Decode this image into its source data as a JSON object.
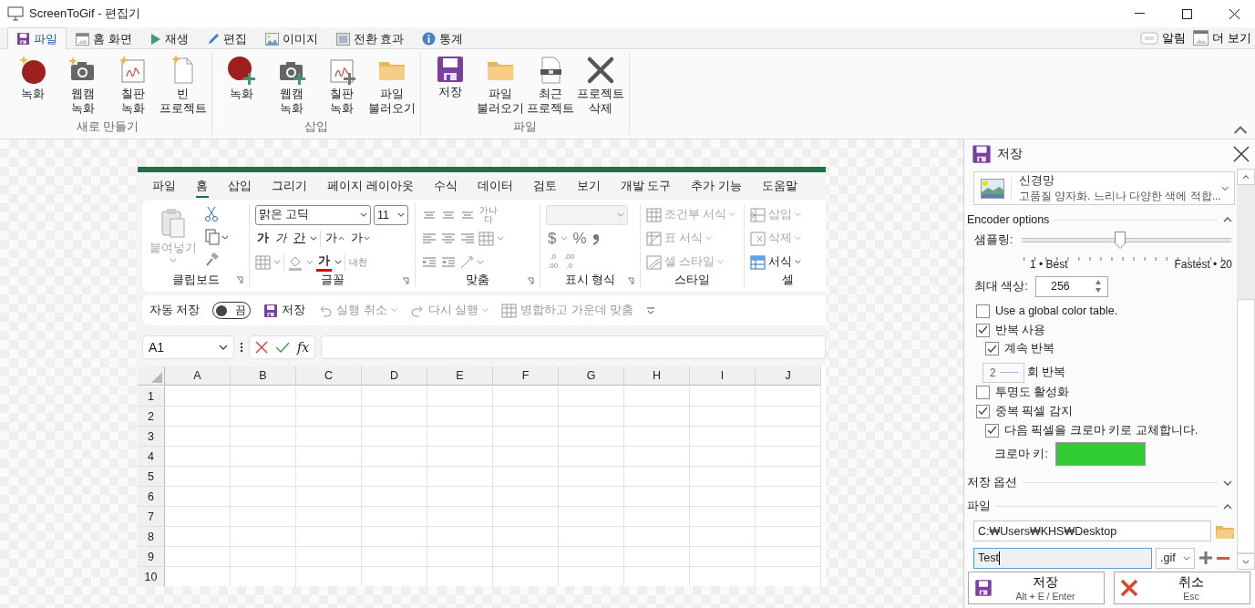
{
  "window": {
    "title": "ScreenToGif - 편집기"
  },
  "tabs": [
    {
      "label": "파일",
      "kind": "save",
      "selected": true
    },
    {
      "label": "홈 화면",
      "kind": "home",
      "selected": false
    },
    {
      "label": "재생",
      "kind": "play",
      "selected": false
    },
    {
      "label": "편집",
      "kind": "pencil",
      "selected": false
    },
    {
      "label": "이미지",
      "kind": "image",
      "selected": false
    },
    {
      "label": "전환 효과",
      "kind": "transition",
      "selected": false
    },
    {
      "label": "통계",
      "kind": "info",
      "selected": false
    }
  ],
  "tab_extras": [
    {
      "label": "알림",
      "kind": "tag"
    },
    {
      "label": "더 보기",
      "kind": "window"
    }
  ],
  "ribbon_groups": [
    {
      "label": "새로 만들기",
      "buttons": [
        {
          "label": "녹화",
          "kind": "record"
        },
        {
          "label": "웹캠\n녹화",
          "kind": "webcam"
        },
        {
          "label": "칠판\n녹화",
          "kind": "board"
        },
        {
          "label": "빈\n프로젝트",
          "kind": "blank"
        }
      ]
    },
    {
      "label": "삽입",
      "buttons": [
        {
          "label": "녹화",
          "kind": "record-add"
        },
        {
          "label": "웹캠\n녹화",
          "kind": "webcam-add"
        },
        {
          "label": "칠판\n녹화",
          "kind": "board-add"
        },
        {
          "label": "파일\n불러오기",
          "kind": "open"
        }
      ]
    },
    {
      "label": "파일",
      "buttons": [
        {
          "label": "저장",
          "kind": "save"
        },
        {
          "label": "파일\n불러오기",
          "kind": "open"
        },
        {
          "label": "최근\n프로젝트",
          "kind": "recent"
        },
        {
          "label": "프로젝트\n삭제",
          "kind": "discard"
        }
      ]
    }
  ],
  "excel": {
    "menu": [
      {
        "label": "파일",
        "selected": false
      },
      {
        "label": "홈",
        "selected": true
      },
      {
        "label": "삽입",
        "selected": false
      },
      {
        "label": "그리기",
        "selected": false
      },
      {
        "label": "페이지 레이아웃",
        "selected": false
      },
      {
        "label": "수식",
        "selected": false
      },
      {
        "label": "데이터",
        "selected": false
      },
      {
        "label": "검토",
        "selected": false
      },
      {
        "label": "보기",
        "selected": false
      },
      {
        "label": "개발 도구",
        "selected": false
      },
      {
        "label": "추가 기능",
        "selected": false
      },
      {
        "label": "도움말",
        "selected": false
      }
    ],
    "clipboard": {
      "paste": "붙여넣기",
      "group": "클립보드"
    },
    "font": {
      "name": "맑은 고딕",
      "size": "11",
      "bold": "가",
      "italic": "가",
      "underline": "간",
      "grow": "가",
      "shrink": "가",
      "color_letter": "가",
      "phonetic": "내천",
      "group": "글꼴"
    },
    "align": {
      "wrap": "가나다",
      "group": "맞춤"
    },
    "number": {
      "currency": "$",
      "percent": "%",
      "dec_inc": [
        ".0",
        ".00"
      ],
      "dec_dec": [
        ".00",
        ".0"
      ],
      "group": "표시 형식"
    },
    "styles": {
      "items": [
        "조건부 서식",
        "표 서식",
        "셀 스타일"
      ],
      "group": "스타일"
    },
    "cells": {
      "items": [
        {
          "label": "삽입",
          "disabled": true
        },
        {
          "label": "삭제",
          "disabled": true
        },
        {
          "label": "서식",
          "disabled": false
        }
      ],
      "group": "셀"
    },
    "quick": {
      "autosave_label": "자동 저장",
      "autosave": {
        "on": false,
        "label": "끔"
      },
      "save": "저장",
      "undo": "실행 취소",
      "redo": "다시 실행",
      "merge": "병합하고 가운데 맞춤"
    },
    "formula": {
      "name_box": "A1",
      "fx": "fx"
    },
    "columns": [
      "A",
      "B",
      "C",
      "D",
      "E",
      "F",
      "G",
      "H",
      "I",
      "J"
    ],
    "rows": [
      "1",
      "2",
      "3",
      "4",
      "5",
      "6",
      "7",
      "8",
      "9",
      "10"
    ]
  },
  "panel": {
    "title": "저장",
    "preset": {
      "name": "신경망",
      "description": "고품질 양자화. 느리나 다양한 색에 적합..."
    },
    "encoder": {
      "title": "Encoder options",
      "expanded": true,
      "sampling": {
        "label": "샘플링:",
        "level": 0.47,
        "min_label": "1 • Best",
        "max_label": "Fastest • 20"
      },
      "max_colors": {
        "label": "최대 색상:",
        "value": "256"
      },
      "options": [
        {
          "kind": "checkbox",
          "label": "Use a global color table.",
          "checked": false
        },
        {
          "kind": "checkbox",
          "label": "반복 사용",
          "checked": true,
          "children": [
            {
              "kind": "checkbox",
              "label": "계속 반복",
              "checked": true
            },
            {
              "kind": "count",
              "value": "2",
              "label": "회 반복",
              "disabled": true
            }
          ]
        },
        {
          "kind": "checkbox",
          "label": "투명도 활성화",
          "checked": false
        },
        {
          "kind": "checkbox",
          "label": "중복 픽셀 감지",
          "checked": true,
          "children": [
            {
              "kind": "checkbox",
              "label": "다음 픽셀을 크로마 키로 교체합니다.",
              "checked": true
            },
            {
              "kind": "color",
              "label": "크로마 키:",
              "color": "#32cd32"
            }
          ]
        }
      ]
    },
    "save_options": {
      "title": "저장 옵션",
      "expanded": false
    },
    "file": {
      "title": "파일",
      "expanded": true,
      "folder": "C:₩Users₩KHS₩Desktop",
      "filename": "Test",
      "extension": ".gif"
    },
    "actions": [
      {
        "kind": "save",
        "label": "저장",
        "shortcut": "Alt + E / Enter"
      },
      {
        "kind": "cancel",
        "label": "취소",
        "shortcut": "Esc"
      }
    ]
  }
}
